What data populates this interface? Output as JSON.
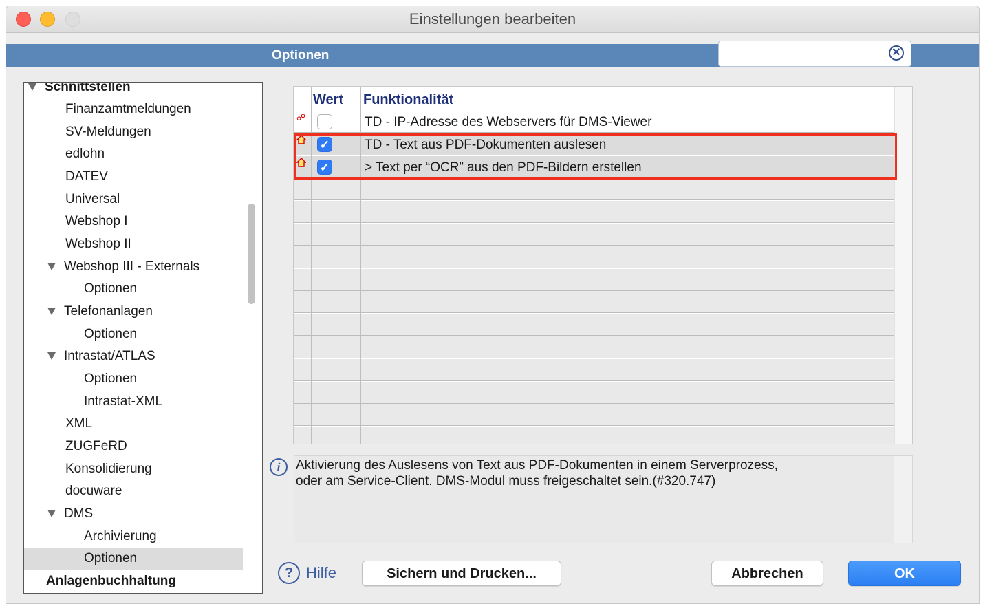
{
  "window": {
    "title": "Einstellungen bearbeiten"
  },
  "header": {
    "title": "Optionen",
    "search": {
      "value": "",
      "placeholder": ""
    }
  },
  "tree": {
    "items": [
      {
        "label": "Schnittstellen",
        "bold": true,
        "expanded": true
      },
      {
        "label": "Finanzamtmeldungen"
      },
      {
        "label": "SV-Meldungen"
      },
      {
        "label": "edlohn"
      },
      {
        "label": "DATEV"
      },
      {
        "label": "Universal"
      },
      {
        "label": "Webshop I"
      },
      {
        "label": "Webshop II"
      },
      {
        "label": "Webshop III - Externals",
        "expanded": true
      },
      {
        "label": "Optionen"
      },
      {
        "label": "Telefonanlagen",
        "expanded": true
      },
      {
        "label": "Optionen"
      },
      {
        "label": "Intrastat/ATLAS",
        "expanded": true
      },
      {
        "label": "Optionen"
      },
      {
        "label": "Intrastat-XML"
      },
      {
        "label": "XML"
      },
      {
        "label": "ZUGFeRD"
      },
      {
        "label": "Konsolidierung"
      },
      {
        "label": "docuware"
      },
      {
        "label": "DMS",
        "expanded": true
      },
      {
        "label": "Archivierung"
      },
      {
        "label": "Optionen",
        "selected": true
      },
      {
        "label": "Anlagenbuchhaltung",
        "bold": true
      }
    ]
  },
  "grid": {
    "columns": {
      "value": "Wert",
      "function": "Funktionalität"
    },
    "rows": [
      {
        "checked": false,
        "icon": "network-icon",
        "label": "TD - IP-Adresse des Webservers für DMS-Viewer"
      },
      {
        "checked": true,
        "icon": "house-icon",
        "label": "TD - Text aus PDF-Dokumenten auslesen"
      },
      {
        "checked": true,
        "icon": "house-icon",
        "label": "> Text per “OCR” aus den PDF-Bildern erstellen"
      }
    ],
    "highlight_color": "#f0301e"
  },
  "info": {
    "line1": "Aktivierung des Auslesens von Text aus PDF-Dokumenten in einem Serverprozess,",
    "line2": "oder am Service-Client. DMS-Modul muss freigeschaltet sein.(#320.747)"
  },
  "footer": {
    "help": "Hilfe",
    "save_print": "Sichern und Drucken...",
    "cancel": "Abbrechen",
    "ok": "OK"
  },
  "colors": {
    "header_bar": "#5b86b8",
    "accent": "#2f7bf6",
    "column_header": "#1d2f79"
  }
}
